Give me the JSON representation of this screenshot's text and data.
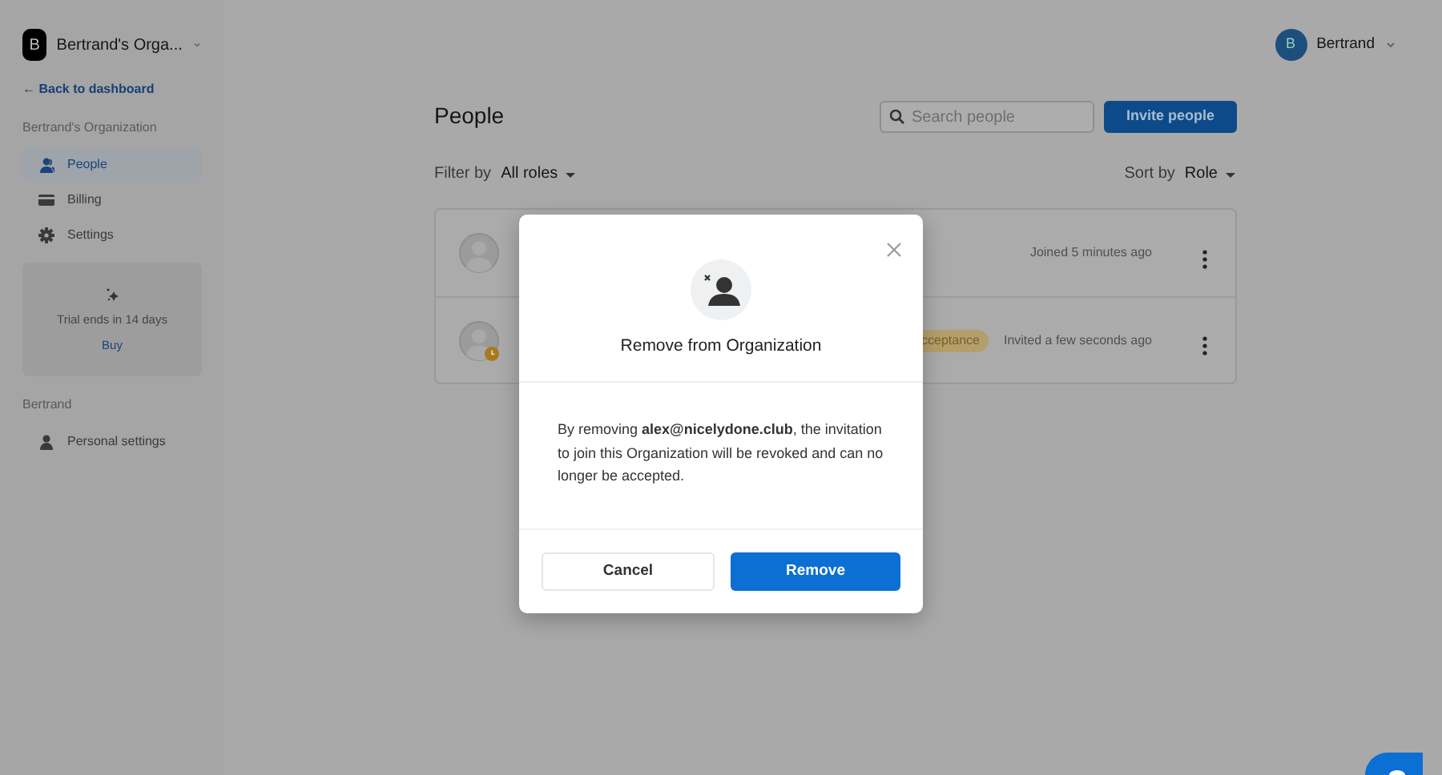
{
  "org_switcher": {
    "initial": "B",
    "name": "Bertrand's Orga..."
  },
  "user_menu": {
    "initial": "B",
    "name": "Bertrand"
  },
  "back_link": "← Back to dashboard",
  "sidebar": {
    "section_title": "Bertrand's Organization",
    "items": [
      {
        "label": "People",
        "kind": "people",
        "selected": true
      },
      {
        "label": "Billing",
        "kind": "card",
        "selected": false
      },
      {
        "label": "Settings",
        "kind": "gear",
        "selected": false
      }
    ],
    "trial": {
      "text": "Trial ends in 14 days",
      "link": "Buy"
    },
    "personal_title": "Bertrand",
    "personal_items": [
      {
        "label": "Personal settings",
        "kind": "person",
        "selected": false
      }
    ]
  },
  "page": {
    "title": "People",
    "search": {
      "placeholder": "Search people"
    },
    "invite_button": "Invite people",
    "filter_label": "Filter by",
    "filter_value": "All roles",
    "sort_label": "Sort by",
    "sort_value": "Role",
    "rows": [
      {
        "status": "Joined 5 minutes ago",
        "pending": false
      },
      {
        "badge": "cceptance",
        "status": "Invited a few seconds ago",
        "pending": true
      }
    ]
  },
  "modal": {
    "title": "Remove from Organization",
    "body": "By removing **alex@nicelydone.club**, the invitation to join this Organization will be revoked and can no longer be accepted.",
    "buttons": [
      {
        "label": "Cancel",
        "kind": "secondary"
      },
      {
        "label": "Remove",
        "kind": "primary"
      }
    ]
  }
}
